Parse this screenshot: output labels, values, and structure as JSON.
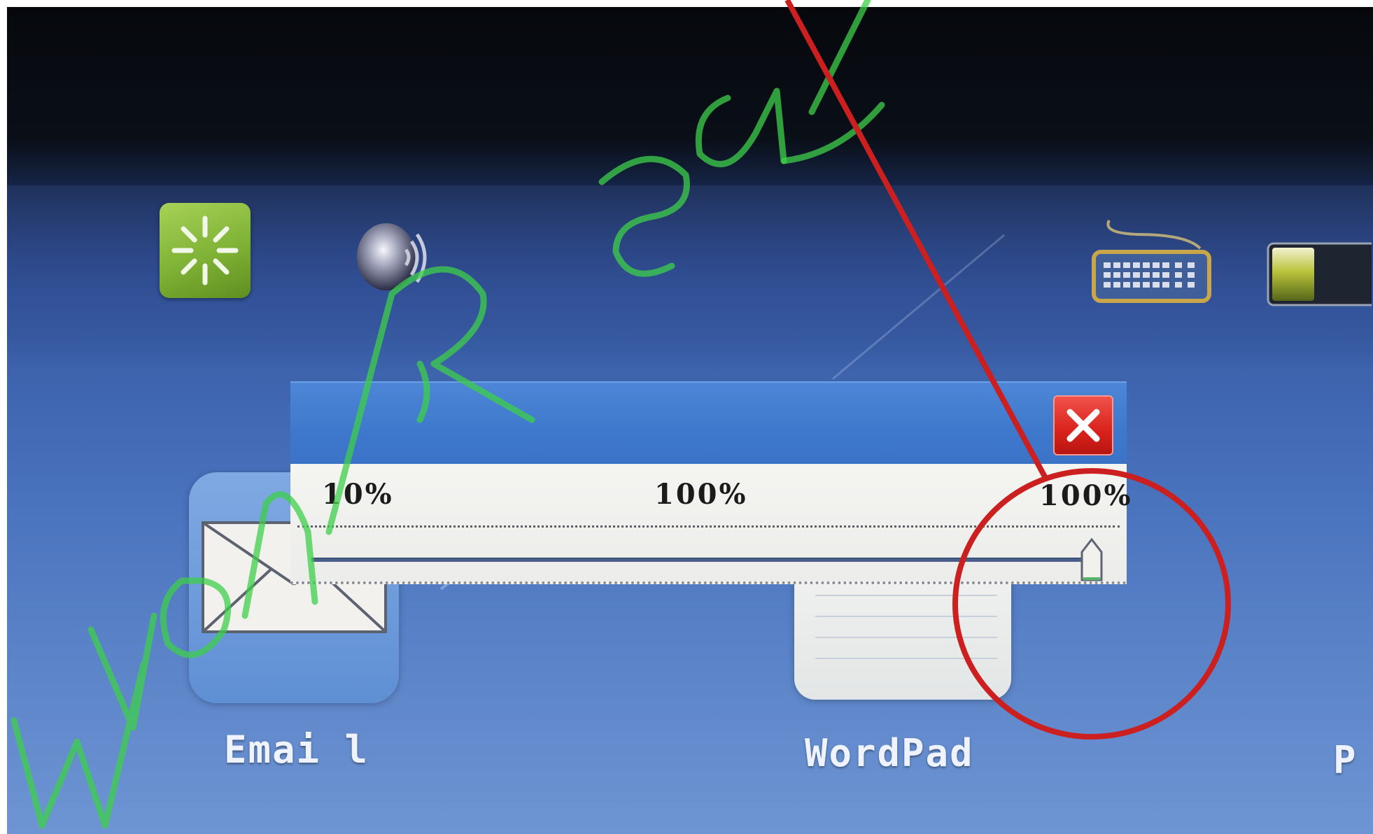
{
  "desktop": {
    "status_icons": [
      {
        "icon": "loading-icon"
      },
      {
        "icon": "speaker-icon"
      },
      {
        "icon": "keyboard-icon"
      },
      {
        "icon": "battery-icon"
      }
    ],
    "apps": [
      {
        "label": "Emai l",
        "icon": "email-icon"
      },
      {
        "label": "WordPad",
        "icon": "wordpad-icon"
      },
      {
        "label": "P",
        "icon": "partial-app-icon"
      }
    ]
  },
  "dialog": {
    "scale_min": "10%",
    "scale_mid": "100%",
    "scale_max": "100%",
    "slider_level_fraction": 1.0,
    "close_icon": "close-icon"
  },
  "annotations": {
    "watermark_text": "WonReal",
    "highlight_color": "#cc1f1f",
    "watermark_color": "#3ecf4a"
  },
  "colors": {
    "close_button": "#d9221c",
    "loading_tile": "#7fb235",
    "dialog_titlebar": "#3e78cc"
  }
}
